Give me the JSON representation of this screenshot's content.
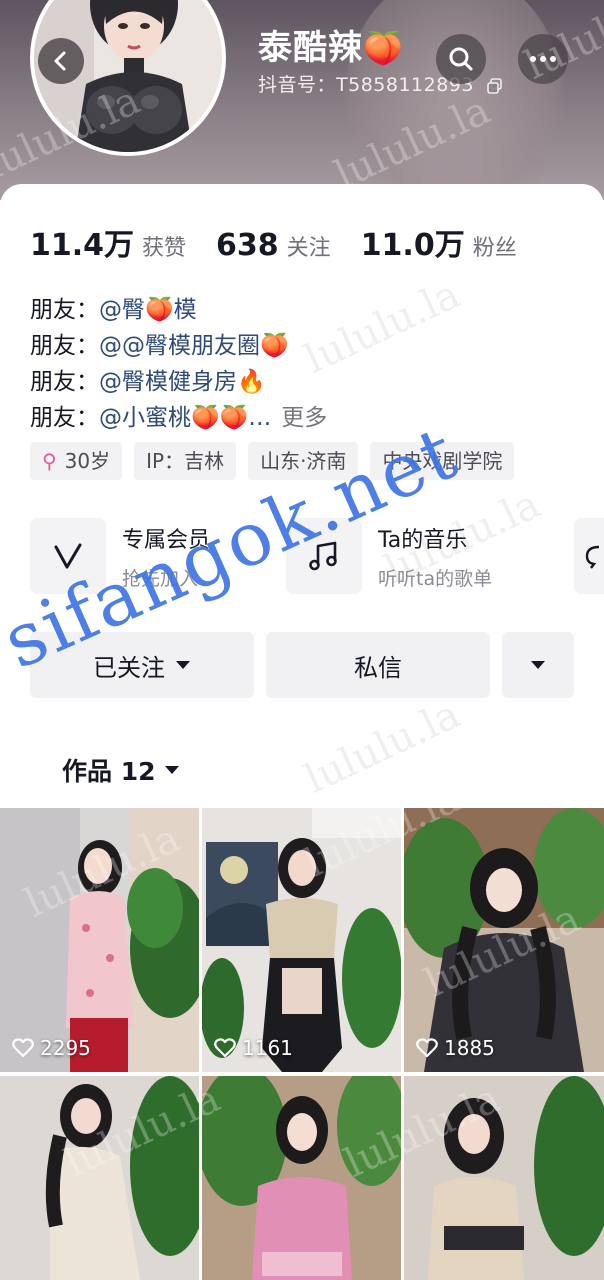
{
  "header": {
    "nickname": "泰酷辣",
    "nickname_emoji": "🍑",
    "douyin_id": "抖音号：T5858112893",
    "back_icon": "chevron-left-icon",
    "search_icon": "search-icon",
    "more_icon": "more-horizontal-icon"
  },
  "stats": [
    {
      "num": "11.4万",
      "label": "获赞"
    },
    {
      "num": "638",
      "label": "关注"
    },
    {
      "num": "11.0万",
      "label": "粉丝"
    }
  ],
  "friends": [
    {
      "label": "朋友：",
      "value": "@臀🍑模"
    },
    {
      "label": "朋友：",
      "value": "@@臀模朋友圈🍑"
    },
    {
      "label": "朋友：",
      "value": "@臀模健身房🔥"
    },
    {
      "label": "朋友：",
      "value": "@小蜜桃🍑🍑…",
      "more": "更多"
    }
  ],
  "tags": {
    "age": "30岁",
    "age_glyph": "⚲",
    "ip": "IP：吉林",
    "location": "山东·济南",
    "school": "中央戏剧学院"
  },
  "services": [
    {
      "title": "专属会员",
      "subtitle": "抢先加入",
      "icon": "vip-v-icon"
    },
    {
      "title": "Ta的音乐",
      "subtitle": "听听ta的歌单",
      "icon": "music-note-icon"
    }
  ],
  "actions": {
    "followed": "已关注",
    "message": "私信",
    "dropdown_icon": "caret-down-icon"
  },
  "works": {
    "label": "作品 12"
  },
  "videos": [
    {
      "likes": "2295"
    },
    {
      "likes": "1161"
    },
    {
      "likes": "1885"
    },
    {
      "likes": ""
    },
    {
      "likes": ""
    },
    {
      "likes": ""
    }
  ],
  "watermarks": {
    "small": "lululu.la",
    "big": "sifangok.net"
  },
  "colors": {
    "link": "#2f4a7a",
    "watermark_blue": "#3f75e6",
    "age_pink": "#e15a9c"
  }
}
